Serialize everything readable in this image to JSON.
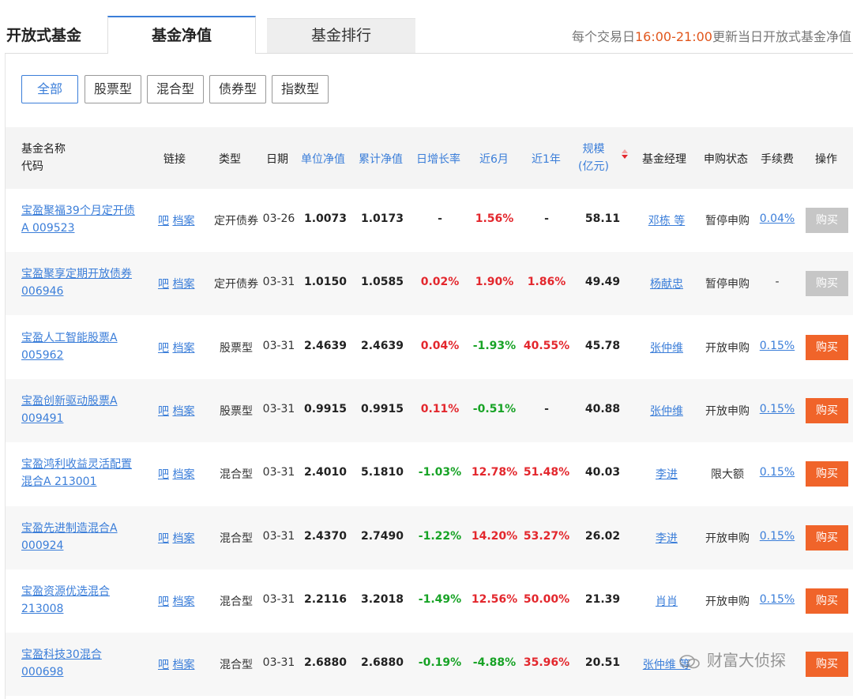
{
  "header": {
    "title": "开放式基金",
    "tabs": [
      {
        "label": "基金净值",
        "active": true
      },
      {
        "label": "基金排行",
        "active": false
      }
    ],
    "notice_prefix": "每个交易日",
    "notice_time": "16:00-21:00",
    "notice_suffix": "更新当日开放式基金净值"
  },
  "filters": [
    "全部",
    "股票型",
    "混合型",
    "债券型",
    "指数型"
  ],
  "table": {
    "columns": {
      "name_line1": "基金名称",
      "name_line2": "代码",
      "link": "链接",
      "type": "类型",
      "date": "日期",
      "nav": "单位净值",
      "acc_nav": "累计净值",
      "daily": "日增长率",
      "m6": "近6月",
      "y1": "近1年",
      "scale_line1": "规模",
      "scale_line2": "(亿元)",
      "manager": "基金经理",
      "status": "申购状态",
      "fee": "手续费",
      "action": "操作"
    },
    "link_labels": {
      "bar": "吧",
      "file": "档案"
    },
    "rows": [
      {
        "name1": "宝盈聚福39个月定开债",
        "name2": "A  009523",
        "type": "定开债券",
        "date": "03-26",
        "nav": "1.0073",
        "acc": "1.0173",
        "daily": "-",
        "m6": "1.56%",
        "y1": "-",
        "scale": "58.11",
        "manager": "邓栋 等",
        "status": "暂停申购",
        "fee": "0.04%",
        "buy": "购买",
        "buy_enabled": false
      },
      {
        "name1": "宝盈聚享定期开放债券",
        "name2": "006946",
        "type": "定开债券",
        "date": "03-31",
        "nav": "1.0150",
        "acc": "1.0585",
        "daily": "0.02%",
        "m6": "1.90%",
        "y1": "1.86%",
        "scale": "49.49",
        "manager": "杨献忠",
        "status": "暂停申购",
        "fee": "-",
        "buy": "购买",
        "buy_enabled": false
      },
      {
        "name1": "宝盈人工智能股票A",
        "name2": "005962",
        "type": "股票型",
        "date": "03-31",
        "nav": "2.4639",
        "acc": "2.4639",
        "daily": "0.04%",
        "m6": "-1.93%",
        "y1": "40.55%",
        "scale": "45.78",
        "manager": "张仲维",
        "status": "开放申购",
        "fee": "0.15%",
        "buy": "购买",
        "buy_enabled": true
      },
      {
        "name1": "宝盈创新驱动股票A",
        "name2": "009491",
        "type": "股票型",
        "date": "03-31",
        "nav": "0.9915",
        "acc": "0.9915",
        "daily": "0.11%",
        "m6": "-0.51%",
        "y1": "-",
        "scale": "40.88",
        "manager": "张仲维",
        "status": "开放申购",
        "fee": "0.15%",
        "buy": "购买",
        "buy_enabled": true
      },
      {
        "name1": "宝盈鸿利收益灵活配置",
        "name2": "混合A  213001",
        "type": "混合型",
        "date": "03-31",
        "nav": "2.4010",
        "acc": "5.1810",
        "daily": "-1.03%",
        "m6": "12.78%",
        "y1": "51.48%",
        "scale": "40.03",
        "manager": "李进",
        "status": "限大额",
        "fee": "0.15%",
        "buy": "购买",
        "buy_enabled": true
      },
      {
        "name1": "宝盈先进制造混合A",
        "name2": "000924",
        "type": "混合型",
        "date": "03-31",
        "nav": "2.4370",
        "acc": "2.7490",
        "daily": "-1.22%",
        "m6": "14.20%",
        "y1": "53.27%",
        "scale": "26.02",
        "manager": "李进",
        "status": "开放申购",
        "fee": "0.15%",
        "buy": "购买",
        "buy_enabled": true
      },
      {
        "name1": "宝盈资源优选混合",
        "name2": "213008",
        "type": "混合型",
        "date": "03-31",
        "nav": "2.2116",
        "acc": "3.2018",
        "daily": "-1.49%",
        "m6": "12.56%",
        "y1": "50.00%",
        "scale": "21.39",
        "manager": "肖肖",
        "status": "开放申购",
        "fee": "0.15%",
        "buy": "购买",
        "buy_enabled": true
      },
      {
        "name1": "宝盈科技30混合",
        "name2": "000698",
        "type": "混合型",
        "date": "03-31",
        "nav": "2.6880",
        "acc": "2.6880",
        "daily": "-0.19%",
        "m6": "-4.88%",
        "y1": "35.96%",
        "scale": "20.51",
        "manager": "张仲维 等",
        "status": "",
        "fee": "",
        "buy": "购买",
        "buy_enabled": true
      }
    ]
  },
  "watermark": "财富大侦探",
  "colors": {
    "accent": "#3b7ed9",
    "up": "#e3272d",
    "down": "#18a326",
    "buy": "#f0642a",
    "buy_disabled": "#c6c6c6"
  }
}
